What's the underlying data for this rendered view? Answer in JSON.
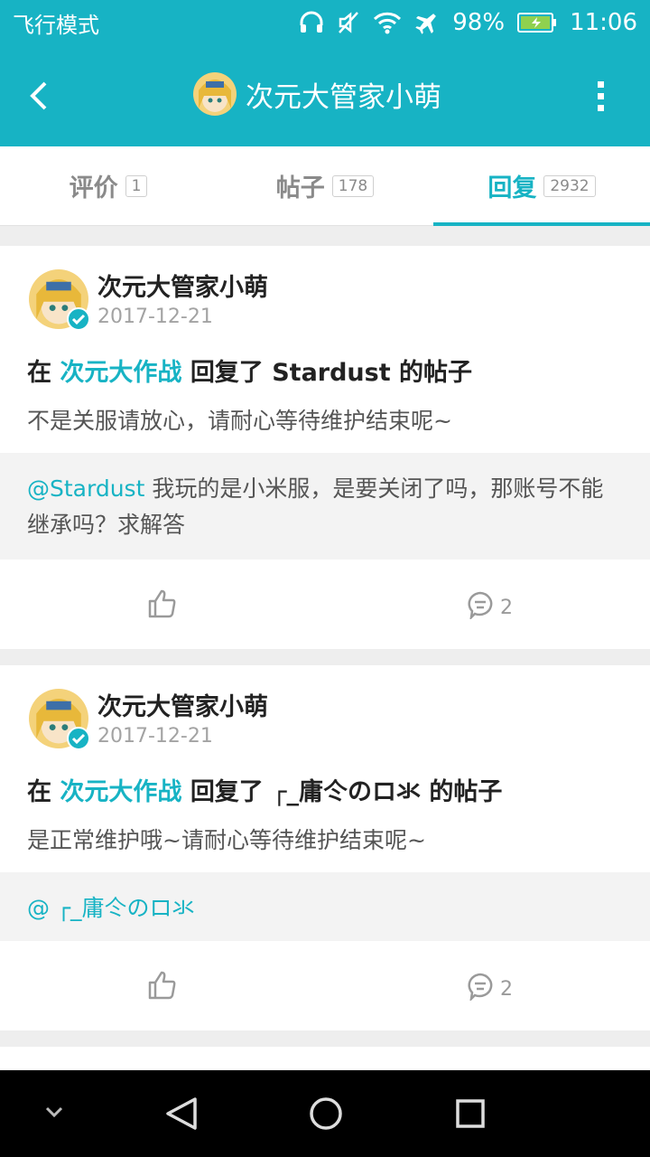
{
  "status": {
    "mode": "飞行模式",
    "battery": "98%",
    "time": "11:06",
    "icons": [
      "headphones-icon",
      "mute-icon",
      "wifi-icon",
      "airplane-icon",
      "battery-icon"
    ]
  },
  "appbar": {
    "title": "次元大管家小萌",
    "back_icon": "back-arrow-icon",
    "more_icon": "more-vertical-icon"
  },
  "tabs": [
    {
      "label": "评价",
      "count": "1",
      "active": false
    },
    {
      "label": "帖子",
      "count": "178",
      "active": false
    },
    {
      "label": "回复",
      "count": "2932",
      "active": true
    }
  ],
  "posts": [
    {
      "author": "次元大管家小萌",
      "date": "2017-12-21",
      "prefix": "在",
      "game": "次元大作战",
      "middle": "回复了 Stardust 的帖子",
      "body": "不是关服请放心，请耐心等待维护结束呢~",
      "mention": "@Stardust",
      "quote": "我玩的是小米服，是要关闭了吗，那账号不能继承吗？求解答",
      "comments": "2"
    },
    {
      "author": "次元大管家小萌",
      "date": "2017-12-21",
      "prefix": "在",
      "game": "次元大作战",
      "middle": "回复了 ┌_庸仒のロ氺 的帖子",
      "body": "是正常维护哦~请耐心等待维护结束呢~",
      "mention": "@ ┌_庸仒のロ氺",
      "quote": "",
      "comments": "2"
    }
  ],
  "colors": {
    "accent": "#17b3c4",
    "background": "#eeeeee"
  }
}
